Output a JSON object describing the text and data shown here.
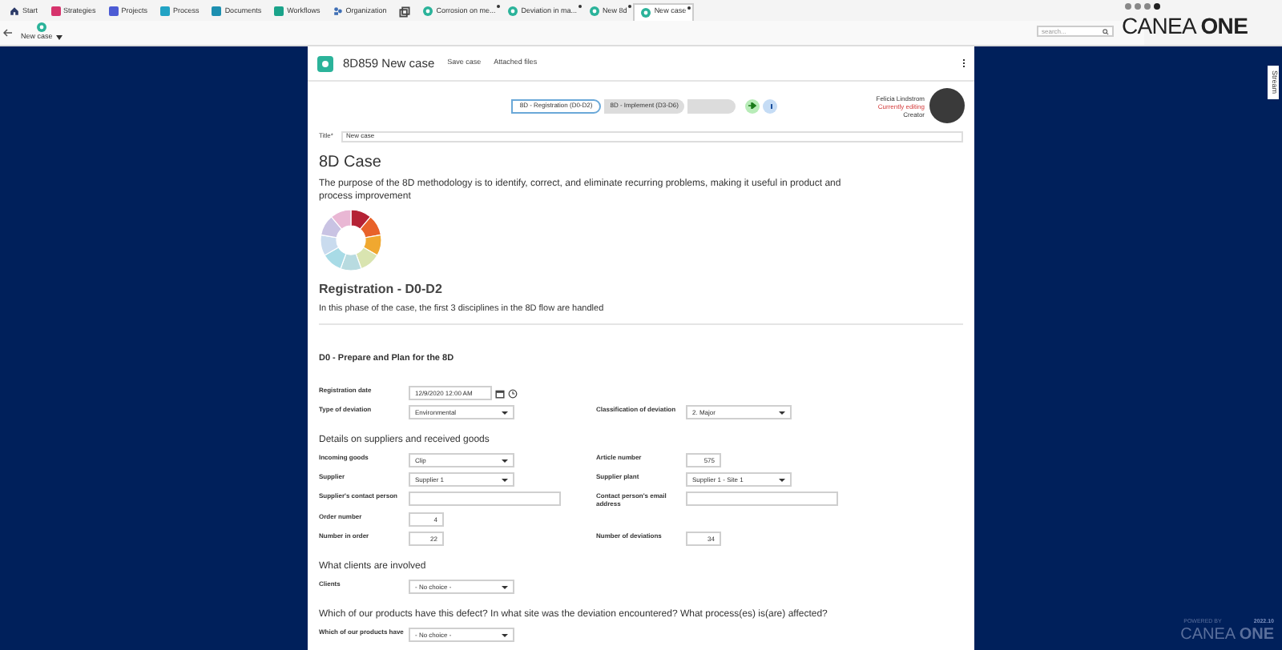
{
  "nav_tabs": [
    {
      "label": "Start",
      "kind": "home",
      "color": "#2b3a67",
      "selected": false
    },
    {
      "label": "Strategies",
      "kind": "module",
      "color": "#d6336c",
      "selected": false
    },
    {
      "label": "Projects",
      "kind": "module",
      "color": "#4c5bd4",
      "selected": false
    },
    {
      "label": "Process",
      "kind": "module",
      "color": "#22a3c4",
      "selected": false
    },
    {
      "label": "Documents",
      "kind": "module",
      "color": "#1c8fb0",
      "selected": false
    },
    {
      "label": "Workflows",
      "kind": "module",
      "color": "#1aa38a",
      "selected": false
    },
    {
      "label": "Organization",
      "kind": "org",
      "color": "#3f6fb5",
      "selected": false
    },
    {
      "kind": "windows",
      "color": "#444444",
      "selected": false
    },
    {
      "label": "Corrosion on me...",
      "kind": "case",
      "color": "#2bb39a",
      "selected": false,
      "closable": true
    },
    {
      "label": "Deviation in ma...",
      "kind": "case",
      "color": "#2bb39a",
      "selected": false,
      "closable": true
    },
    {
      "label": "New 8d",
      "kind": "case",
      "color": "#2bb39a",
      "selected": false,
      "closable": true
    },
    {
      "label": "New case",
      "kind": "case",
      "color": "#2bb39a",
      "selected": true,
      "closable": true
    }
  ],
  "sub_tab": {
    "label": "New case"
  },
  "search": {
    "placeholder": "search..."
  },
  "brand": {
    "name": "CANEA",
    "strong": "ONE"
  },
  "case": {
    "title": "8D859 New case",
    "actions": [
      "Save case",
      "Attached files"
    ],
    "phases": [
      {
        "label": "8D - Registration (D0-D2)",
        "selected": true
      },
      {
        "label": "8D - Implement (D3-D6)",
        "selected": false
      },
      {
        "selected": false
      }
    ],
    "user": {
      "name": "Felicia Lindstrom",
      "status": "Currently editing",
      "role": "Creator"
    },
    "title_field": {
      "label": "Title*",
      "value": "New case"
    },
    "heading": "8D Case",
    "intro": "The purpose of the 8D methodology is to identify, correct, and eliminate recurring problems, making it useful in product and process improvement",
    "phase_heading": "Registration - D0-D2",
    "phase_text": "In this phase of the case, the first 3 disciplines in the 8D flow are handled",
    "section": "D0 - Prepare and Plan for the 8D",
    "form": [
      {
        "kind": "row",
        "left": {
          "label": "Registration date",
          "kind": "date",
          "value": "12/9/2020 12:00 AM"
        }
      },
      {
        "kind": "row",
        "left": {
          "label": "Type of deviation",
          "kind": "select",
          "value": "Environmental"
        },
        "right": {
          "label": "Classification of deviation",
          "kind": "select",
          "value": "2. Major"
        }
      },
      {
        "kind": "heading",
        "text": "Details on suppliers and received goods"
      },
      {
        "kind": "row",
        "left": {
          "label": "Incoming goods",
          "kind": "select",
          "value": "Clip"
        },
        "right": {
          "label": "Article number",
          "kind": "number",
          "value": "575"
        }
      },
      {
        "kind": "row",
        "left": {
          "label": "Supplier",
          "kind": "select",
          "value": "Supplier 1"
        },
        "right": {
          "label": "Supplier plant",
          "kind": "select",
          "value": "Supplier 1 - Site 1"
        }
      },
      {
        "kind": "row",
        "left": {
          "label": "Supplier's contact person",
          "kind": "text"
        },
        "right": {
          "label": "Contact person's email address",
          "kind": "text"
        }
      },
      {
        "kind": "row",
        "left": {
          "label": "Order number",
          "kind": "number",
          "value": "4"
        }
      },
      {
        "kind": "row",
        "left": {
          "label": "Number in order",
          "kind": "number",
          "value": "22"
        },
        "right": {
          "label": "Number of deviations",
          "kind": "number",
          "value": "34"
        }
      },
      {
        "kind": "heading",
        "text": "What clients are involved"
      },
      {
        "kind": "row",
        "left": {
          "label": "Clients",
          "kind": "select",
          "value": "- No choice -"
        }
      },
      {
        "kind": "heading",
        "text": "Which of our products have this defect? In what site was the deviation encountered? What process(es) is(are) affected?"
      },
      {
        "kind": "row",
        "left": {
          "label": "Which of our products have",
          "kind": "select",
          "value": "- No choice -"
        }
      }
    ]
  },
  "stream_tab": {
    "label": "Stream"
  },
  "footer": {
    "powered": "POWERED BY",
    "name": "CANEA",
    "strong": "ONE",
    "version": "2022.10"
  }
}
